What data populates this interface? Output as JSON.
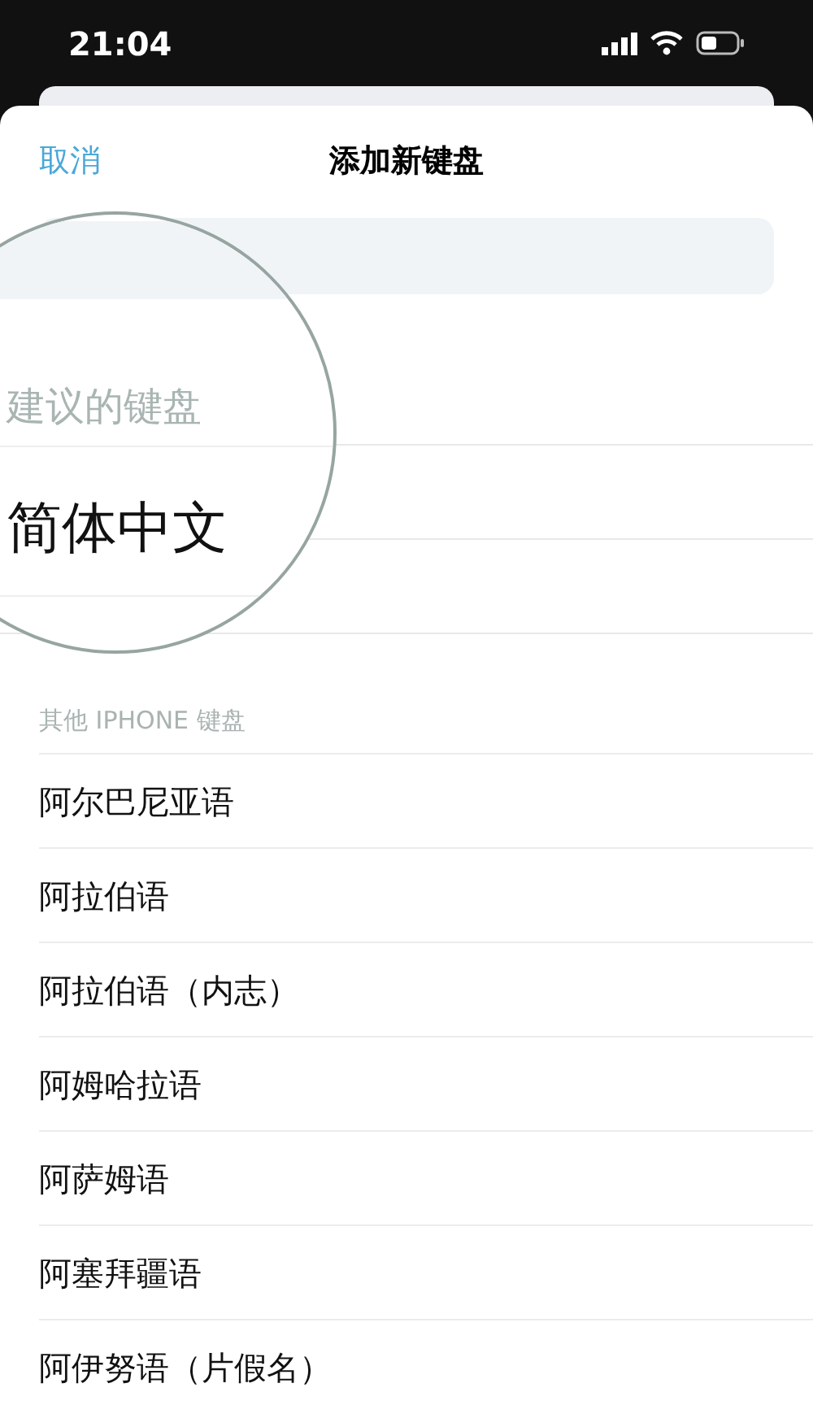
{
  "status_bar": {
    "time": "21:04"
  },
  "nav": {
    "cancel": "取消",
    "title": "添加新键盘"
  },
  "magnifier": {
    "section_header": "建议的键盘",
    "item": "简体中文"
  },
  "other_section": {
    "header": "其他 IPHONE 键盘",
    "items": [
      {
        "label": "阿尔巴尼亚语"
      },
      {
        "label": "阿拉伯语"
      },
      {
        "label": "阿拉伯语（内志）"
      },
      {
        "label": "阿姆哈拉语"
      },
      {
        "label": "阿萨姆语"
      },
      {
        "label": "阿塞拜疆语"
      },
      {
        "label": "阿伊努语（片假名）"
      }
    ]
  }
}
